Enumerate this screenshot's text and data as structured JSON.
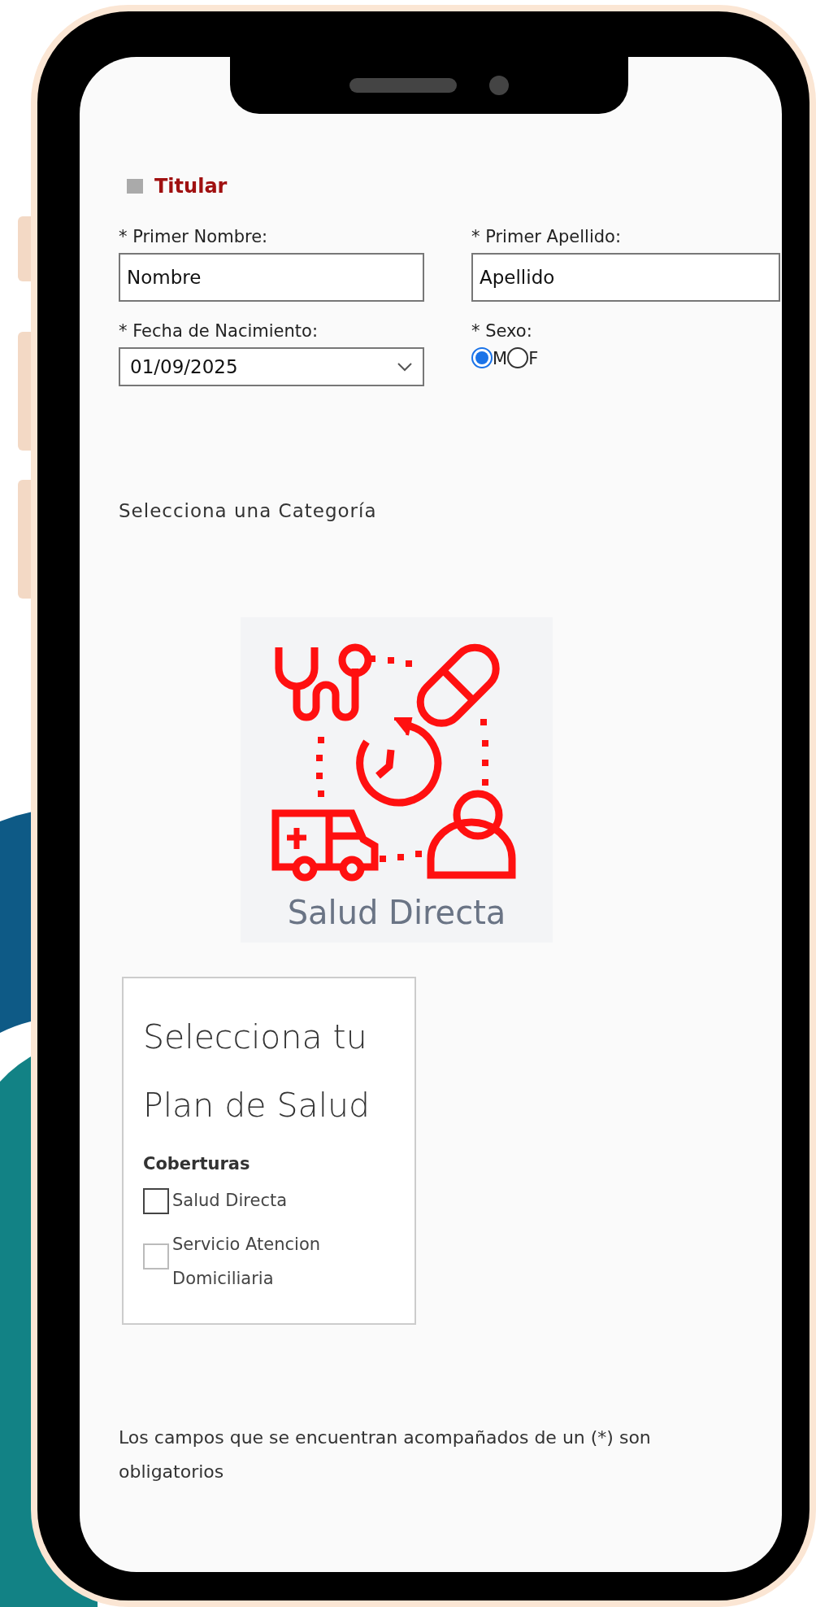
{
  "section": {
    "title": "Titular"
  },
  "fields": [
    {
      "kind": "text",
      "label": "* Primer Nombre:",
      "value": "Nombre"
    },
    {
      "kind": "text",
      "label": "* Primer Apellido:",
      "value": "Apellido"
    },
    {
      "kind": "date",
      "label": "* Fecha de Nacimiento:",
      "value": "01/09/2025"
    },
    {
      "kind": "radio",
      "label": "* Sexo:",
      "options": [
        {
          "label": "M",
          "selected": true
        },
        {
          "label": "F",
          "selected": false
        }
      ]
    }
  ],
  "category": {
    "heading": "Selecciona una Categoría",
    "card_label": "Salud Directa"
  },
  "plan": {
    "title": "Selecciona tu Plan de Salud",
    "subtitle": "Coberturas",
    "options": [
      {
        "label": "Salud Directa",
        "checked": false,
        "disabled": false
      },
      {
        "label": "Servicio Atencion Domiciliaria",
        "checked": false,
        "disabled": true
      }
    ]
  },
  "footnote": "Los campos que se encuentran acompañados de un (*) son obligatorios"
}
